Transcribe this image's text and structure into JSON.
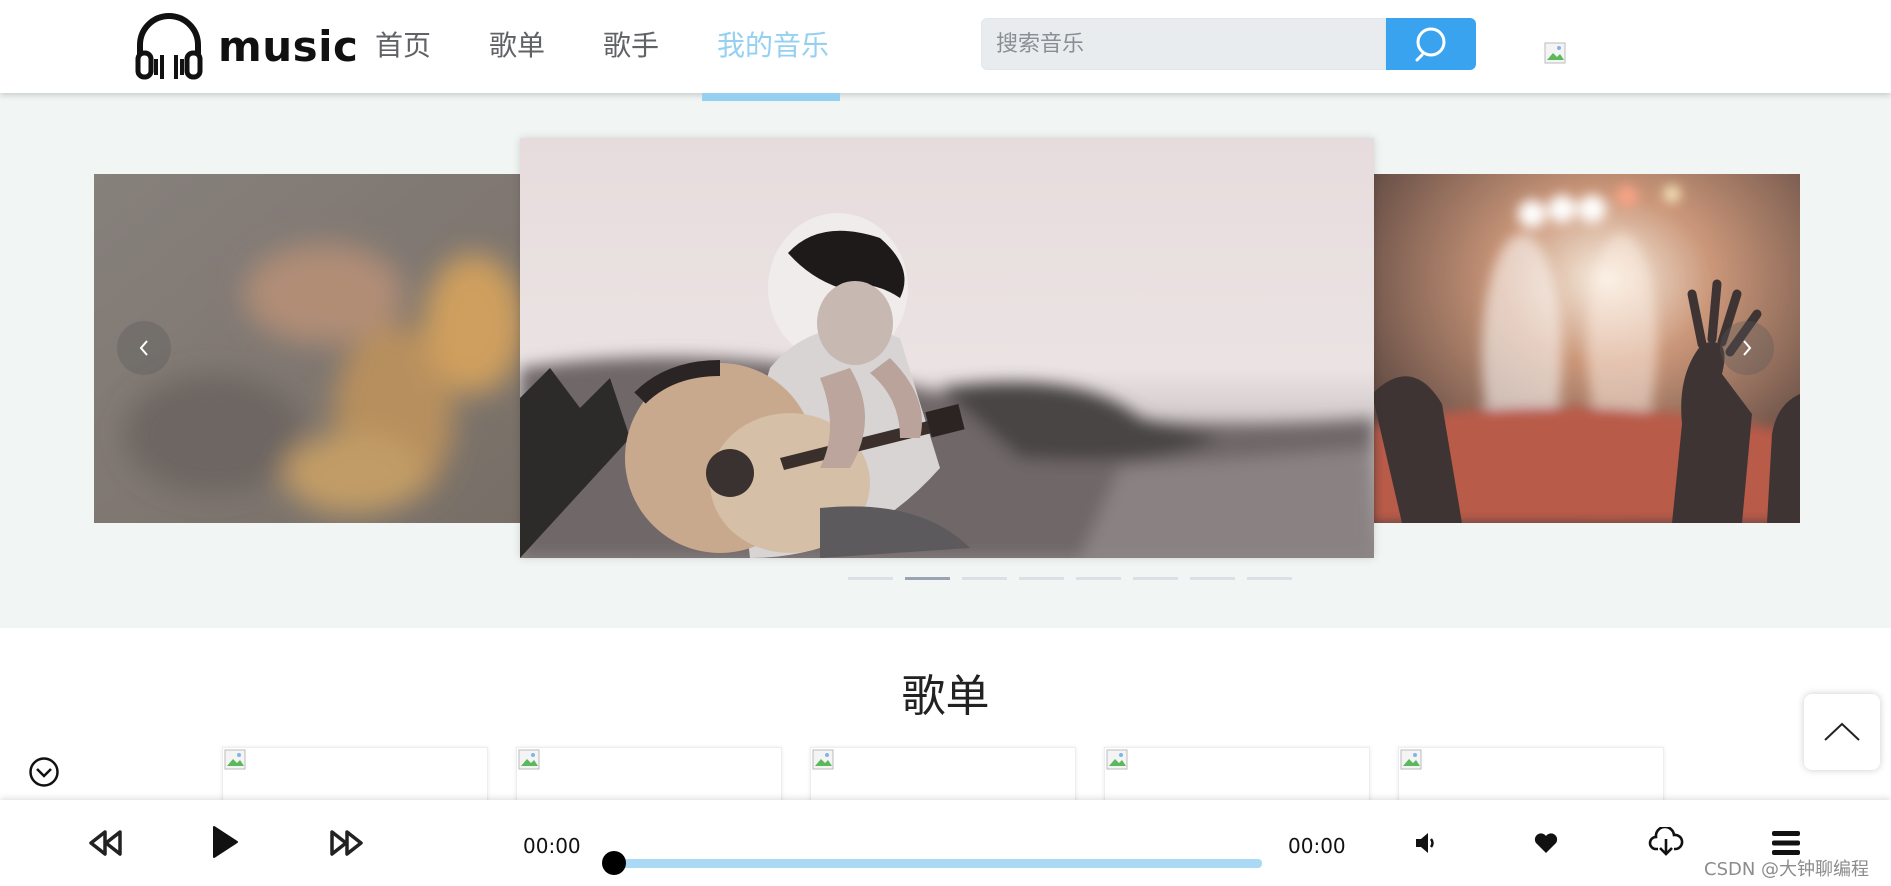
{
  "header": {
    "logo_text": "music",
    "nav": [
      {
        "label": "首页",
        "active": false
      },
      {
        "label": "歌单",
        "active": false
      },
      {
        "label": "歌手",
        "active": false
      },
      {
        "label": "我的音乐",
        "active": true
      }
    ],
    "search": {
      "placeholder": "搜索音乐",
      "value": ""
    }
  },
  "banner": {
    "slides": [
      "blurred-guitar-photo",
      "boy-playing-guitar-photo",
      "concert-crowd-photo"
    ],
    "indicator_count": 8,
    "active_indicator": 2
  },
  "section": {
    "title": "歌单",
    "cards": 5
  },
  "player": {
    "current_time": "00:00",
    "total_time": "00:00",
    "progress": 0
  },
  "watermark": "CSDN @大钟聊编程",
  "colors": {
    "accent": "#95d0f0",
    "search_button": "#3aa3f0",
    "banner_bg": "#f1f5f3",
    "progress": "#a9d9f5"
  }
}
